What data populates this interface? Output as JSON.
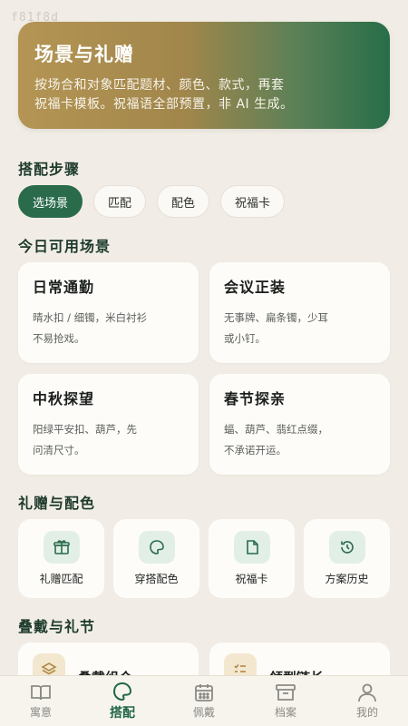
{
  "watermark": "f81f8d",
  "hero": {
    "title": "场景与礼赠",
    "desc_line1": "按场合和对象匹配题材、颜色、款式，再套",
    "desc_line2": "祝福卡模板。祝福语全部预置，非 AI 生成。"
  },
  "steps_section": {
    "title": "搭配步骤",
    "steps": [
      "选场景",
      "匹配",
      "配色",
      "祝福卡"
    ],
    "active_index": 0
  },
  "scenes_section": {
    "title": "今日可用场景",
    "cards": [
      {
        "title": "日常通勤",
        "line1": "晴水扣 / 细镯，米白衬衫",
        "line2": "不易抢戏。"
      },
      {
        "title": "会议正装",
        "line1": "无事牌、扁条镯，少耳",
        "line2": "或小钉。"
      },
      {
        "title": "中秋探望",
        "line1": "阳绿平安扣、葫芦，先",
        "line2": "问清尺寸。"
      },
      {
        "title": "春节探亲",
        "line1": "蝠、葫芦、翡红点缀，",
        "line2": "不承诺开运。"
      }
    ]
  },
  "tools_section": {
    "title": "礼赠与配色",
    "items": [
      {
        "label": "礼赠匹配",
        "icon": "gift-icon"
      },
      {
        "label": "穿搭配色",
        "icon": "palette-icon"
      },
      {
        "label": "祝福卡",
        "icon": "card-icon"
      },
      {
        "label": "方案历史",
        "icon": "history-icon"
      }
    ]
  },
  "stack_section": {
    "title": "叠戴与礼节",
    "items": [
      {
        "label": "叠戴组合",
        "icon": "layers-icon"
      },
      {
        "label": "领型链长",
        "icon": "list-icon"
      }
    ]
  },
  "tabbar": {
    "tabs": [
      {
        "label": "寓意",
        "icon": "book-icon"
      },
      {
        "label": "搭配",
        "icon": "palette-icon"
      },
      {
        "label": "佩戴",
        "icon": "calendar-icon"
      },
      {
        "label": "档案",
        "icon": "archive-icon"
      },
      {
        "label": "我的",
        "icon": "user-icon"
      }
    ],
    "active_index": 1
  },
  "colors": {
    "accent": "#2a6b4b",
    "background": "#f1ede6",
    "hero_start": "#b49554",
    "hero_end": "#276e48"
  }
}
